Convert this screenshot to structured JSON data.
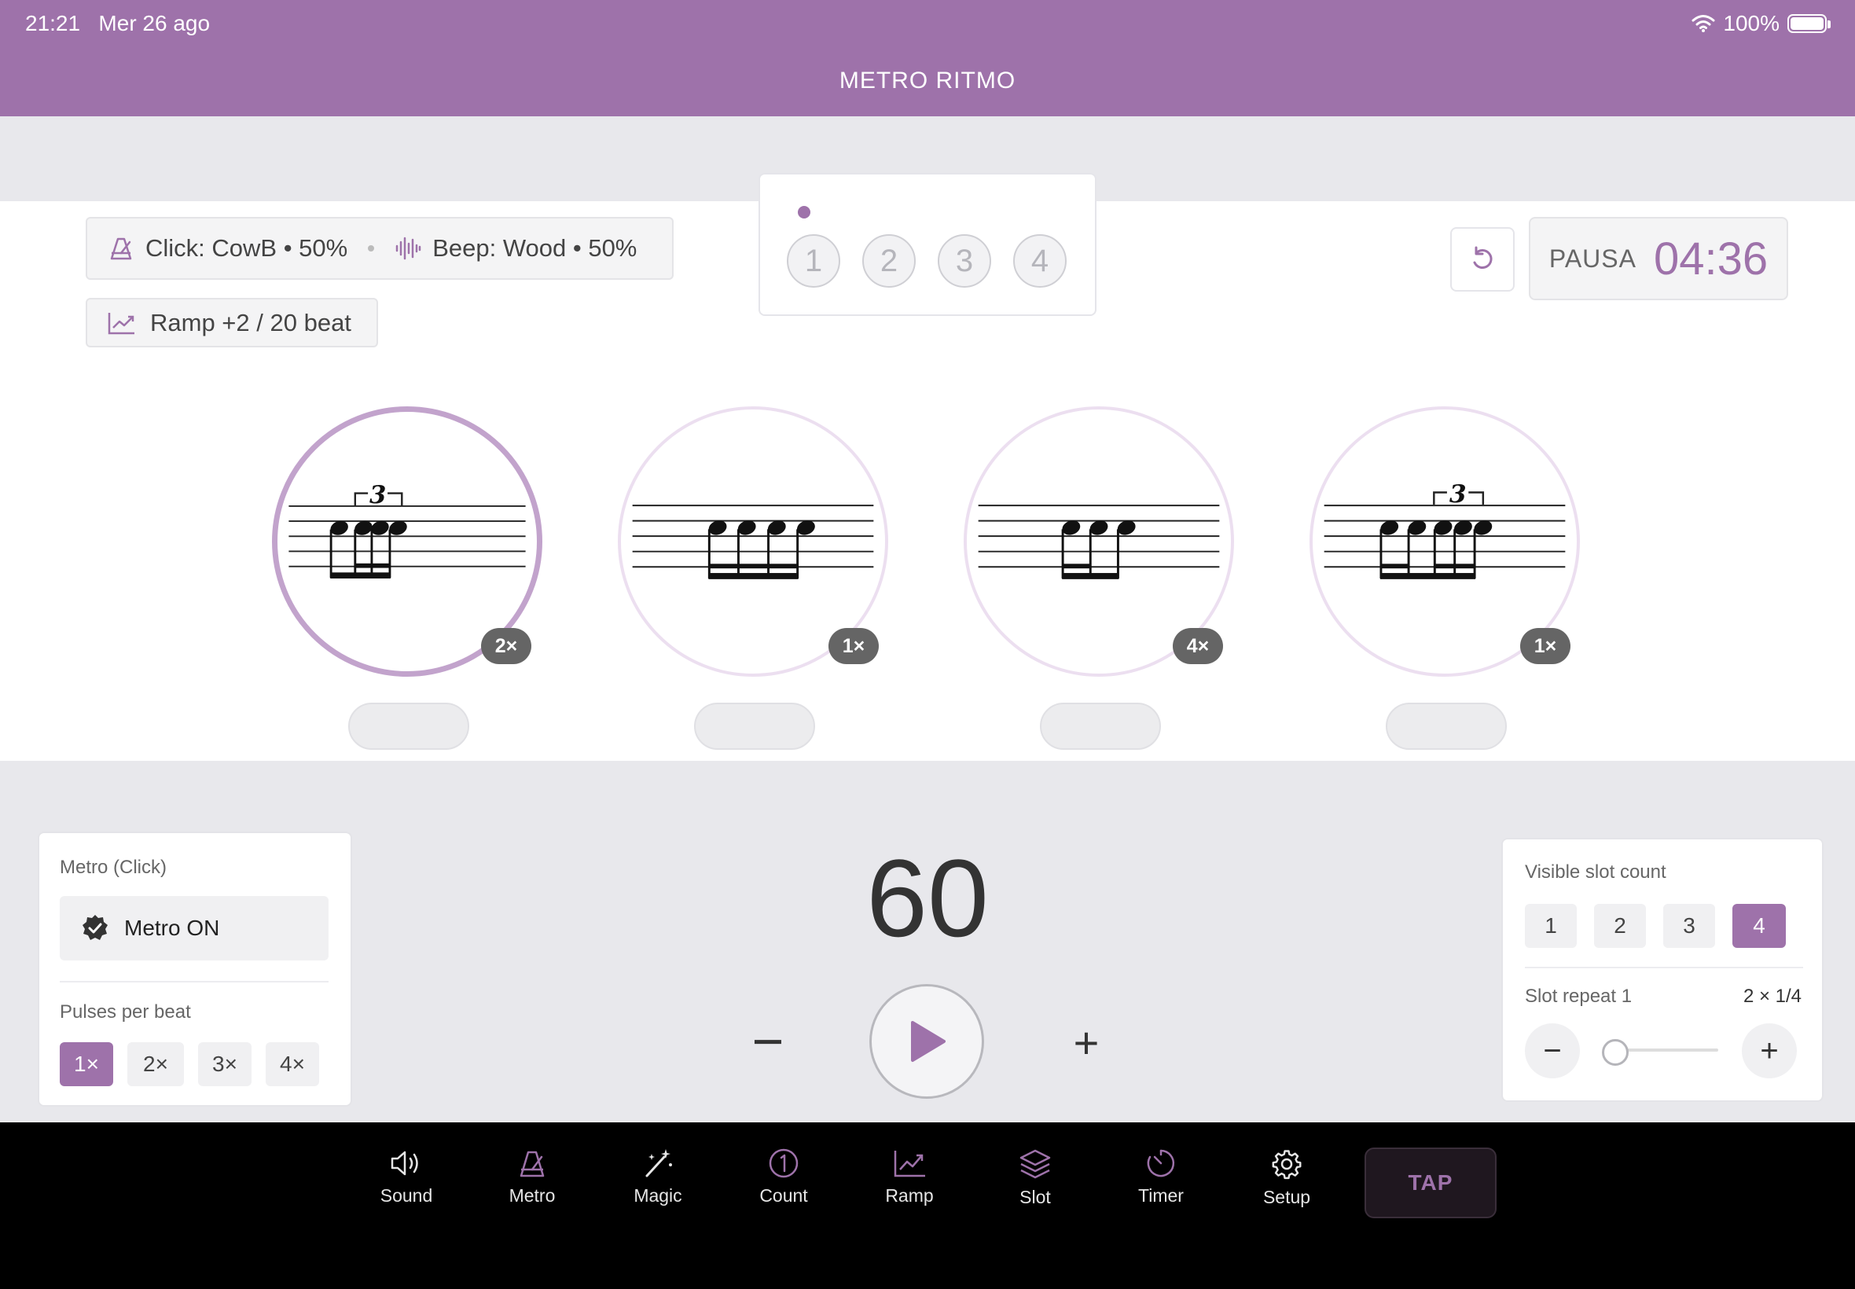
{
  "status_bar": {
    "time": "21:21",
    "date": "Mer 26 ago",
    "battery": "100%"
  },
  "app_title": "METRO RITMO",
  "sound": {
    "click": "Click: CowB • 50%",
    "beep": "Beep: Wood • 50%",
    "ramp": "Ramp +2 / 20 beat"
  },
  "beats": [
    "1",
    "2",
    "3",
    "4"
  ],
  "timer": {
    "label": "PAUSA",
    "value": "04:36"
  },
  "slots": [
    {
      "repeat": "2×",
      "tuplet": "3"
    },
    {
      "repeat": "1×"
    },
    {
      "repeat": "4×"
    },
    {
      "repeat": "1×",
      "tuplet": "3"
    }
  ],
  "metro": {
    "title": "Metro (Click)",
    "toggle": "Metro ON",
    "pulses_label": "Pulses per beat",
    "pulses": [
      "1×",
      "2×",
      "3×",
      "4×"
    ],
    "selected_pulse": "1×"
  },
  "tempo": {
    "bpm": "60",
    "minus": "−",
    "plus": "+"
  },
  "slot_panel": {
    "count_label": "Visible slot count",
    "counts": [
      "1",
      "2",
      "3",
      "4"
    ],
    "selected_count": "4",
    "repeat_label": "Slot repeat 1",
    "repeat_value": "2 × 1/4",
    "minus": "−",
    "plus": "+"
  },
  "nav": {
    "items": [
      "Sound",
      "Metro",
      "Magic",
      "Count",
      "Ramp",
      "Slot",
      "Timer",
      "Setup"
    ],
    "tap": "TAP"
  },
  "colors": {
    "accent": "#9e72aa",
    "header": "#9e72aa",
    "nav_bg": "#000000"
  }
}
